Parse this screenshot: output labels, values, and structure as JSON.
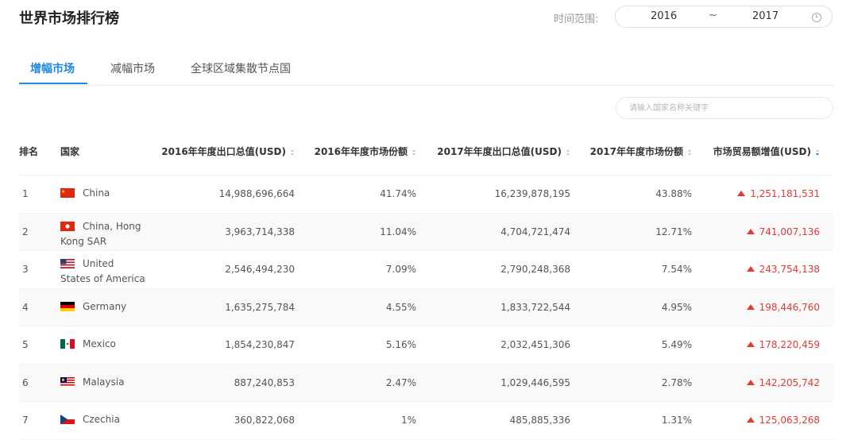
{
  "header": {
    "title": "世界市场排行榜",
    "time_label": "时间范围:",
    "range_start": "2016",
    "range_sep": "~",
    "range_end": "2017"
  },
  "tabs": [
    {
      "label": "增幅市场",
      "active": true
    },
    {
      "label": "减幅市场",
      "active": false
    },
    {
      "label": "全球区域集散节点国",
      "active": false
    }
  ],
  "search": {
    "placeholder": "请输入国家名称关键字"
  },
  "table": {
    "columns": [
      "排名",
      "国家",
      "2016年年度出口总值(USD)",
      "2016年年度市场份额",
      "2017年年度出口总值(USD)",
      "2017年年度市场份额",
      "市场贸易额增值(USD)"
    ],
    "rows": [
      {
        "rank": "1",
        "country_line1": "China",
        "country_line2": "",
        "flag": "cn-flag-icon",
        "exp2016": "14,988,696,664",
        "share2016": "41.74%",
        "exp2017": "16,239,878,195",
        "share2017": "43.88%",
        "increase": "1,251,181,531"
      },
      {
        "rank": "2",
        "country_line1": "China, Hong",
        "country_line2": "Kong SAR",
        "flag": "hk-flag-icon",
        "exp2016": "3,963,714,338",
        "share2016": "11.04%",
        "exp2017": "4,704,721,474",
        "share2017": "12.71%",
        "increase": "741,007,136"
      },
      {
        "rank": "3",
        "country_line1": "United",
        "country_line2": "States of America",
        "flag": "us-flag-icon",
        "exp2016": "2,546,494,230",
        "share2016": "7.09%",
        "exp2017": "2,790,248,368",
        "share2017": "7.54%",
        "increase": "243,754,138"
      },
      {
        "rank": "4",
        "country_line1": "Germany",
        "country_line2": "",
        "flag": "de-flag-icon",
        "exp2016": "1,635,275,784",
        "share2016": "4.55%",
        "exp2017": "1,833,722,544",
        "share2017": "4.95%",
        "increase": "198,446,760"
      },
      {
        "rank": "5",
        "country_line1": "Mexico",
        "country_line2": "",
        "flag": "mx-flag-icon",
        "exp2016": "1,854,230,847",
        "share2016": "5.16%",
        "exp2017": "2,032,451,306",
        "share2017": "5.49%",
        "increase": "178,220,459"
      },
      {
        "rank": "6",
        "country_line1": "Malaysia",
        "country_line2": "",
        "flag": "my-flag-icon",
        "exp2016": "887,240,853",
        "share2016": "2.47%",
        "exp2017": "1,029,446,595",
        "share2017": "2.78%",
        "increase": "142,205,742"
      },
      {
        "rank": "7",
        "country_line1": "Czechia",
        "country_line2": "",
        "flag": "cz-flag-icon",
        "exp2016": "360,822,068",
        "share2016": "1%",
        "exp2017": "485,885,336",
        "share2017": "1.31%",
        "increase": "125,063,268"
      }
    ]
  },
  "colors": {
    "accent": "#1e88e5",
    "increase": "#e53935"
  }
}
